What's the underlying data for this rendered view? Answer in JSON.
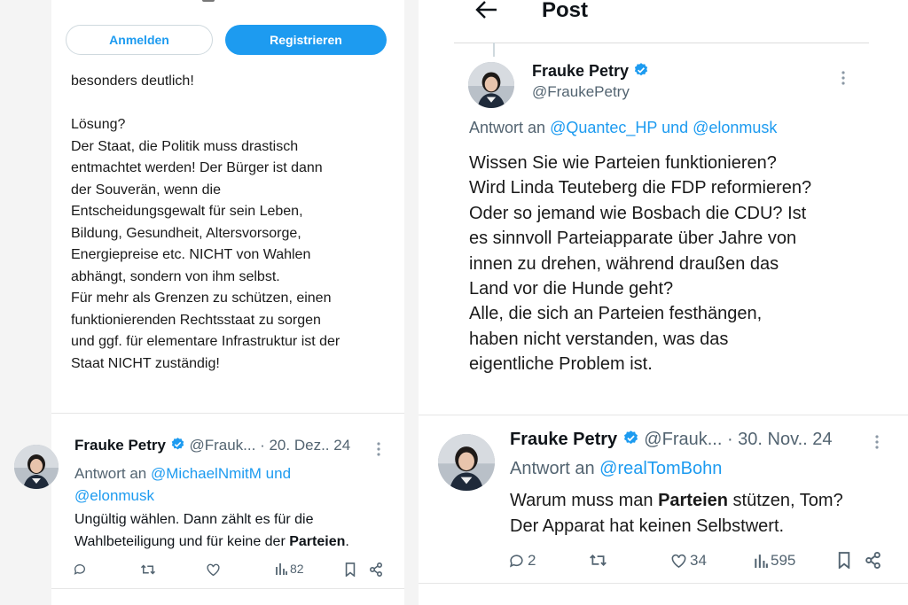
{
  "left": {
    "login_label": "Anmelden",
    "register_label": "Registrieren",
    "post_text": "besonders deutlich!\n\nLösung?\nDer Staat, die Politik muss drastisch\nentmachtet werden! Der Bürger ist dann\nder Souverän, wenn die\nEntscheidungsgewalt für sein Leben,\nBildung, Gesundheit, Altersvorsorge,\nEnergiepreise etc. NICHT von Wahlen\nabhängt, sondern von ihm selbst.\nFür mehr als Grenzen zu schützen, einen\nfunktionierenden Rechtsstaat zu sorgen\nund ggf. für elementare Infrastruktur ist der\nStaat NICHT zuständig!",
    "reply": {
      "name": "Frauke Petry",
      "handle": "@Frauk...",
      "date": "· 20. Dez.. 24",
      "reply_prefix": "Antwort an",
      "reply_to_1": "@MichaelNmitM und",
      "reply_to_2": "@elonmusk",
      "text_1": "Ungültig wählen. Dann zählt es für die",
      "text_2a": "Wahlbeteiligung und für keine der ",
      "text_2b": "Parteien",
      "text_2c": ".",
      "views": "82"
    }
  },
  "right": {
    "header_title": "Post",
    "main": {
      "name": "Frauke Petry",
      "handle": "@FraukePetry",
      "reply_prefix": "Antwort an",
      "reply_to": "@Quantec_HP und @elonmusk",
      "text": "Wissen Sie wie Parteien funktionieren?\nWird Linda Teuteberg die FDP reformieren?\nOder so jemand wie Bosbach die CDU? Ist\nes sinnvoll Parteiapparate über Jahre von\ninnen zu drehen, während draußen das\nLand vor die Hunde geht?\nAlle, die sich an Parteien festhängen,\nhaben nicht verstanden, was das\neigentliche Problem ist."
    },
    "reply": {
      "name": "Frauke Petry",
      "handle": "@Frauk...",
      "date": "· 30. Nov.. 24",
      "reply_prefix": "Antwort an",
      "reply_to": "@realTomBohn",
      "text_1a": "Warum muss man ",
      "text_1b": "Parteien",
      "text_1c": " stützen, Tom?",
      "text_2": "Der Apparat hat keinen Selbstwert.",
      "replies": "2",
      "likes": "34",
      "views": "595"
    }
  },
  "colors": {
    "accent": "#1d9bf0",
    "text": "#0f1419",
    "muted": "#536471"
  },
  "icons": [
    "back-arrow-icon",
    "verified-badge-icon",
    "more-icon",
    "reply-icon",
    "retweet-icon",
    "like-icon",
    "views-icon",
    "bookmark-icon",
    "share-icon"
  ]
}
